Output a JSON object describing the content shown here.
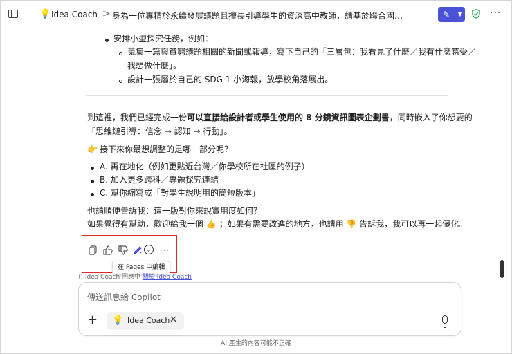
{
  "header": {
    "agent_name": "Idea Coach",
    "separator": ">",
    "chat_title": "身為一位專精於永續發展議題且擅長引導學生的資深高中教師，請基於聯合國永續發展目標的理念，針對高..."
  },
  "content": {
    "bullet_task": "安排小型探究任務，例如：",
    "sub1_line1": "蒐集一篇與貧窮議題相關的新聞或報導，寫下自己的「三層包：我看見了什麼／我有什麼感受／",
    "sub1_line2": "我想做什麼」。",
    "sub2": "設計一張屬於自己的 SDG 1 小海報，放學校角落展出。",
    "summary_pre": "到這裡，我們已經完成一份",
    "summary_bold": "可以直接給設計者或學生使用的 8 分鏡資訊圖表企劃書",
    "summary_post": "，同時嵌入了你想要的",
    "summary_line2": "「思維鏈引導：信念 → 認知 → 行動」。",
    "question_emoji": "👉",
    "question": "接下來你最想調整的是哪一部分呢？",
    "options": [
      "A. 再在地化（例如更貼近台灣／你學校所在社區的例子）",
      "B. 加入更多跨科／專題探究連結",
      "C. 幫你縮寫成「對學生說明用的簡短版本」"
    ],
    "feedback_line1": "也請順便告訴我：這一版對你來說實用度如何？",
    "feedback_pre": "如果覺得有幫助，歡迎給我一個 👍 ；如果有需要改進的地方，也請用 👎 告訴我，我可以再一起優化。"
  },
  "toolbar": {
    "copy_icon": "copy-icon",
    "like_icon": "thumbs-up-icon",
    "dislike_icon": "thumbs-down-icon",
    "edit_icon": "pen-sparkle-icon",
    "chevron_icon": "chevron-down-icon",
    "more_icon": "more-icon",
    "tooltip": "在 Pages 中編輯"
  },
  "attribution": {
    "prefix": "Idea Coach 回應中",
    "link": "關於 Idea Coach"
  },
  "composer": {
    "placeholder": "傳送訊息給 Copilot",
    "chip_label": "Idea Coach"
  },
  "footer": {
    "note": "AI 產生的內容可能不正確"
  },
  "colors": {
    "accent": "#4a52d8",
    "highlight_border": "#e0262b",
    "shield": "#1e9e4a"
  }
}
